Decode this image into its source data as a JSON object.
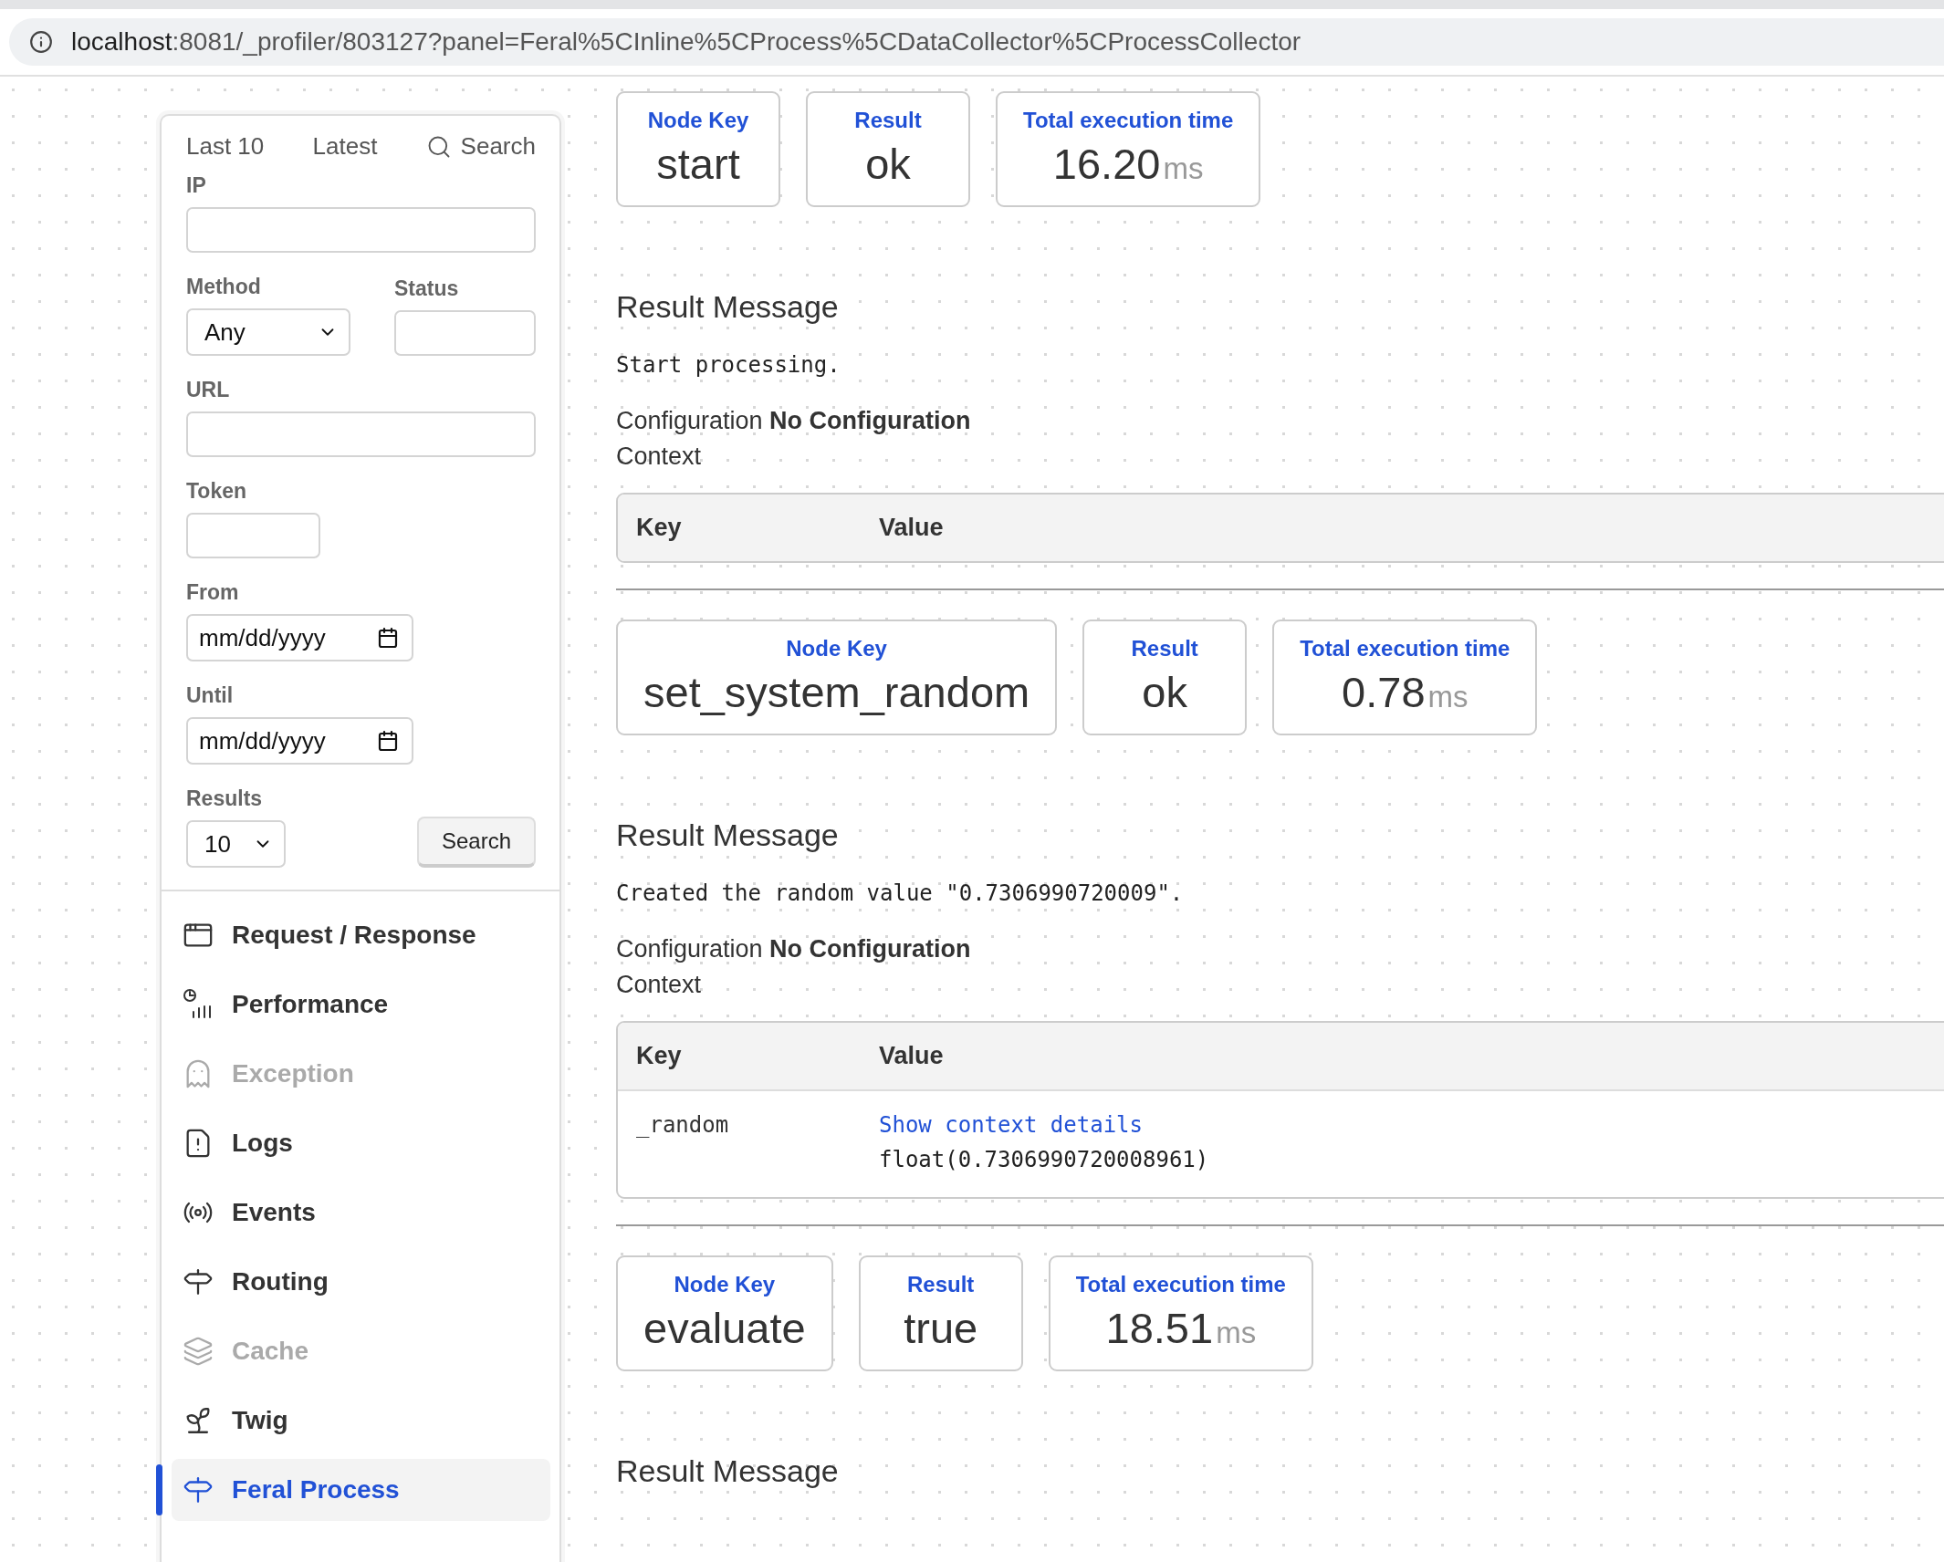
{
  "address_bar": {
    "host": "localhost",
    "path": ":8081/_profiler/803127?panel=Feral%5CInline%5CProcess%5CDataCollector%5CProcessCollector"
  },
  "sidebar": {
    "tabs": [
      {
        "label": "Last 10",
        "kind": "link"
      },
      {
        "label": "Latest",
        "kind": "link"
      },
      {
        "label": "Search",
        "kind": "search"
      }
    ],
    "form": {
      "ip": {
        "label": "IP"
      },
      "method": {
        "label": "Method",
        "value": "Any"
      },
      "status": {
        "label": "Status"
      },
      "url": {
        "label": "URL"
      },
      "token": {
        "label": "Token"
      },
      "from": {
        "label": "From",
        "placeholder": "mm/dd/yyyy"
      },
      "until": {
        "label": "Until",
        "placeholder": "mm/dd/yyyy"
      },
      "results": {
        "label": "Results",
        "value": "10"
      },
      "search_button": "Search"
    },
    "nav": [
      {
        "label": "Request / Response",
        "disabled": false,
        "selected": false
      },
      {
        "label": "Performance",
        "disabled": false,
        "selected": false
      },
      {
        "label": "Exception",
        "disabled": true,
        "selected": false
      },
      {
        "label": "Logs",
        "disabled": false,
        "selected": false
      },
      {
        "label": "Events",
        "disabled": false,
        "selected": false
      },
      {
        "label": "Routing",
        "disabled": false,
        "selected": false
      },
      {
        "label": "Cache",
        "disabled": true,
        "selected": false
      },
      {
        "label": "Twig",
        "disabled": false,
        "selected": false
      },
      {
        "label": "Feral Process",
        "disabled": false,
        "selected": true
      }
    ]
  },
  "steps": [
    {
      "cards": [
        {
          "label": "Node Key",
          "value": "start"
        },
        {
          "label": "Result",
          "value": "ok"
        },
        {
          "label": "Total execution time",
          "value": "16.20",
          "unit": "ms"
        }
      ],
      "heading": "Result Message",
      "message": "Start processing.",
      "configuration": "Configuration **No Configuration**",
      "context": "Context",
      "table": {
        "columns": [
          "Key",
          "Value"
        ]
      }
    },
    {
      "cards": [
        {
          "label": "Node Key",
          "value": "set_system_random"
        },
        {
          "label": "Result",
          "value": "ok"
        },
        {
          "label": "Total execution time",
          "value": "0.78",
          "unit": "ms"
        }
      ],
      "heading": "Result Message",
      "message": "Created the random value \"0.7306990720009\".",
      "configuration": "Configuration **No Configuration**",
      "context": "Context",
      "table": {
        "columns": [
          "Key",
          "Value"
        ],
        "rows": [
          {
            "key": "_random",
            "link": "Show context details",
            "value": "float(0.7306990720008961)"
          }
        ]
      }
    },
    {
      "cards": [
        {
          "label": "Node Key",
          "value": "evaluate"
        },
        {
          "label": "Result",
          "value": "true"
        },
        {
          "label": "Total execution time",
          "value": "18.51",
          "unit": "ms"
        }
      ],
      "heading": "Result Message"
    }
  ]
}
